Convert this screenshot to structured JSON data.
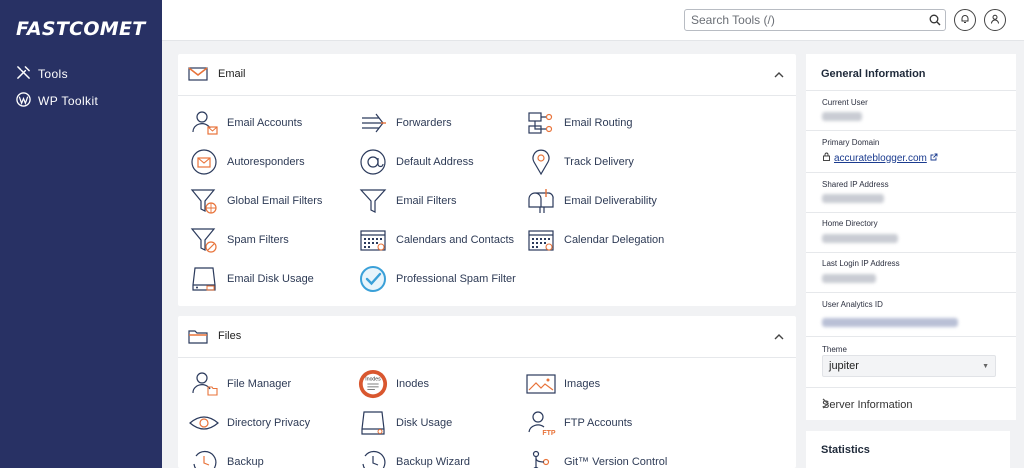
{
  "brand": {
    "logo": "FASTCOMET"
  },
  "sidebar": {
    "items": [
      {
        "label": "Tools",
        "icon": "tools-icon"
      },
      {
        "label": "WP Toolkit",
        "icon": "wordpress-icon"
      }
    ]
  },
  "header": {
    "search_placeholder": "Search Tools (/)"
  },
  "email_section": {
    "title": "Email",
    "tools": [
      {
        "label": "Email Accounts",
        "icon": "email-accounts-icon"
      },
      {
        "label": "Forwarders",
        "icon": "forwarders-icon"
      },
      {
        "label": "Email Routing",
        "icon": "email-routing-icon"
      },
      {
        "label": "Autoresponders",
        "icon": "autoresponders-icon"
      },
      {
        "label": "Default Address",
        "icon": "default-address-icon"
      },
      {
        "label": "Track Delivery",
        "icon": "track-delivery-icon"
      },
      {
        "label": "Global Email Filters",
        "icon": "global-email-filters-icon"
      },
      {
        "label": "Email Filters",
        "icon": "email-filters-icon"
      },
      {
        "label": "Email Deliverability",
        "icon": "email-deliverability-icon"
      },
      {
        "label": "Spam Filters",
        "icon": "spam-filters-icon"
      },
      {
        "label": "Calendars and Contacts",
        "icon": "calendars-contacts-icon"
      },
      {
        "label": "Calendar Delegation",
        "icon": "calendar-delegation-icon"
      },
      {
        "label": "Email Disk Usage",
        "icon": "email-disk-usage-icon"
      },
      {
        "label": "Professional Spam Filter",
        "icon": "professional-spam-filter-icon"
      }
    ]
  },
  "files_section": {
    "title": "Files",
    "tools": [
      {
        "label": "File Manager",
        "icon": "file-manager-icon"
      },
      {
        "label": "Inodes",
        "icon": "inodes-icon",
        "badge": "Inodes"
      },
      {
        "label": "Images",
        "icon": "images-icon"
      },
      {
        "label": "Directory Privacy",
        "icon": "directory-privacy-icon"
      },
      {
        "label": "Disk Usage",
        "icon": "disk-usage-icon"
      },
      {
        "label": "FTP Accounts",
        "icon": "ftp-accounts-icon",
        "badge": "FTP"
      },
      {
        "label": "Backup",
        "icon": "backup-icon"
      },
      {
        "label": "Backup Wizard",
        "icon": "backup-wizard-icon"
      },
      {
        "label": "Git™ Version Control",
        "icon": "git-icon"
      }
    ]
  },
  "general_info": {
    "title": "General Information",
    "current_user_label": "Current User",
    "primary_domain_label": "Primary Domain",
    "primary_domain": "accurateblogger.com",
    "shared_ip_label": "Shared IP Address",
    "home_dir_label": "Home Directory",
    "last_login_label": "Last Login IP Address",
    "analytics_label": "User Analytics ID",
    "theme_label": "Theme",
    "theme_value": "jupiter",
    "server_info": "Server Information"
  },
  "statistics": {
    "title": "Statistics"
  },
  "colors": {
    "sidebar": "#283164",
    "accent_orange": "#e8733a",
    "icon_navy": "#2b3a5c",
    "link": "#1a3b8f",
    "pro_spam_blue": "#3aa0d8"
  }
}
